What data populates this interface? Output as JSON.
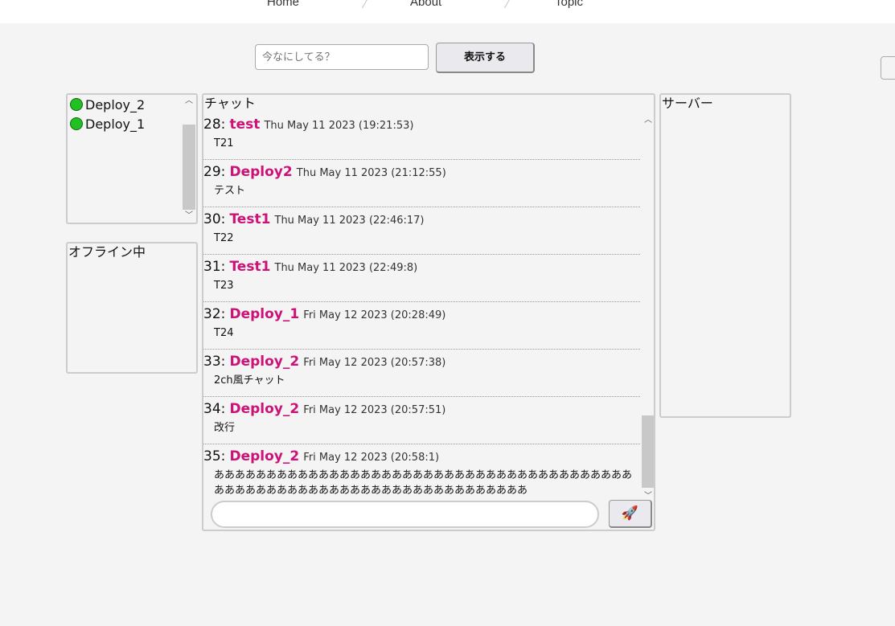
{
  "nav": {
    "items": [
      {
        "label": "Home"
      },
      {
        "label": "About"
      },
      {
        "label": "Topic"
      }
    ]
  },
  "status": {
    "placeholder": "今なにしてる？",
    "button_label": "表示する"
  },
  "online": {
    "users": [
      {
        "name": "Deploy_2"
      },
      {
        "name": "Deploy_1"
      }
    ]
  },
  "offline": {
    "title": "オフライン中"
  },
  "server": {
    "title": "サーバー"
  },
  "chat": {
    "title": "チャット",
    "messages": [
      {
        "num": "28:",
        "name": "test",
        "date": "Thu May 11 2023 (19:21:53)",
        "body": "T21"
      },
      {
        "num": "29:",
        "name": "Deploy2",
        "date": "Thu May 11 2023 (21:12:55)",
        "body": "テスト"
      },
      {
        "num": "30:",
        "name": "Test1",
        "date": "Thu May 11 2023 (22:46:17)",
        "body": "T22"
      },
      {
        "num": "31:",
        "name": "Test1",
        "date": "Thu May 11 2023 (22:49:8)",
        "body": "T23"
      },
      {
        "num": "32:",
        "name": "Deploy_1",
        "date": "Fri May 12 2023 (20:28:49)",
        "body": "T24"
      },
      {
        "num": "33:",
        "name": "Deploy_2",
        "date": "Fri May 12 2023 (20:57:38)",
        "body": "2ch風チャット"
      },
      {
        "num": "34:",
        "name": "Deploy_2",
        "date": "Fri May 12 2023 (20:57:51)",
        "body": "改行"
      },
      {
        "num": "35:",
        "name": "Deploy_2",
        "date": "Fri May 12 2023 (20:58:1)",
        "body": "ああああああああああああああああああああああああああああああああああああああああああああああああああああああああああああああああああああああ"
      }
    ],
    "send_icon": "rocket-icon"
  },
  "colors": {
    "name_accent": "#cc1177",
    "online_dot": "#22c022",
    "background": "#f4f4f4"
  }
}
